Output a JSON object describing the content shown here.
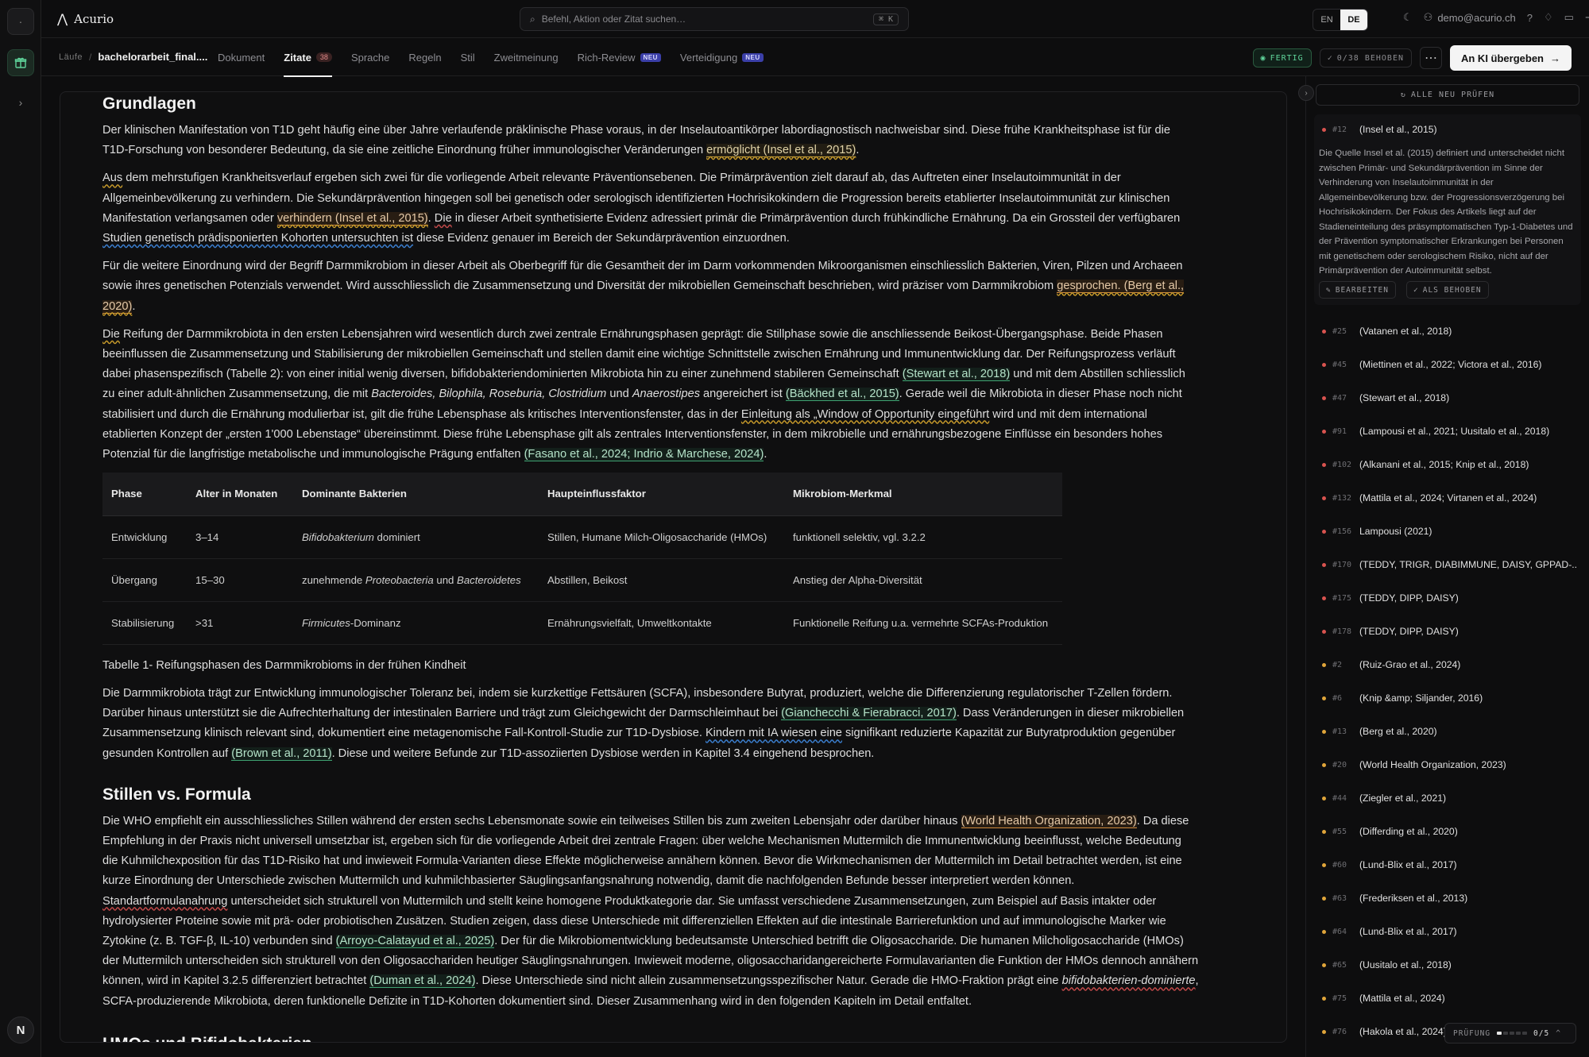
{
  "app": {
    "name": "Acurio"
  },
  "search": {
    "placeholder": "Befehl, Aktion oder Zitat suchen…",
    "shortcut": "⌘ K"
  },
  "languages": [
    {
      "code": "EN",
      "active": false
    },
    {
      "code": "DE",
      "active": true
    }
  ],
  "user": {
    "email": "demo@acurio.ch"
  },
  "breadcrumb": {
    "runs": "Läufe",
    "file": "bachelorarbeit_final...."
  },
  "tabs": [
    {
      "label": "Dokument"
    },
    {
      "label": "Zitate",
      "count": "38",
      "active": true
    },
    {
      "label": "Sprache"
    },
    {
      "label": "Regeln"
    },
    {
      "label": "Stil"
    },
    {
      "label": "Zweitmeinung"
    },
    {
      "label": "Rich-Review",
      "badge": "NEU"
    },
    {
      "label": "Verteidigung",
      "badge": "NEU"
    }
  ],
  "toolbar": {
    "status": "FERTIG",
    "fixed": "0/38 BEHOBEN",
    "handoff": "An KI übergeben"
  },
  "colors": {
    "accent_green": "#5fd39a",
    "accent_yellow": "#c79a2a",
    "accent_orange": "#d38d3e",
    "accent_red": "#c44a4a",
    "neu_badge": "#3b3fa8"
  },
  "document": {
    "h_grundlagen": "Grundlagen",
    "p1a": "Der klinischen Manifestation von T1D geht häufig eine über Jahre verlaufende präklinische Phase voraus, in der Inselautoantikörper labordiagnostisch nachweisbar sind. Diese frühe Krankheitsphase ist für die T1D-Forschung von besonderer Bedeutung, da sie eine zeitliche Einordnung früher immunologischer Veränderungen ",
    "p1b": "ermöglicht (Insel et al., 2015)",
    "p2a": "Aus",
    "p2b": " dem mehrstufigen Krankheitsverlauf ergeben sich zwei für die vorliegende Arbeit relevante Präventionsebenen. Die Primärprävention zielt darauf ab, das Auftreten einer Inselautoimmunität in der Allgemeinbevölkerung zu verhindern. Die Sekundärprävention hingegen soll bei genetisch oder serologisch identifizierten Hochrisikokindern die Progression bereits etablierter Inselautoimmunität zur klinischen Manifestation verlangsamen oder ",
    "p2c": "verhindern (Insel et al., 2015)",
    "p2d": ". ",
    "p2e": "Die",
    "p2f": " in dieser Arbeit synthetisierte Evidenz adressiert primär die Primärprävention durch frühkindliche Ernährung. Da ein Grossteil der verfügbaren ",
    "p2g": "Studien genetisch prädisponierten Kohorten untersuchten ist",
    "p2h": " diese Evidenz genauer im Bereich der Sekundärprävention einzuordnen.",
    "p3a": "Für die weitere Einordnung wird der Begriff Darmmikrobiom in dieser Arbeit als Oberbegriff für die Gesamtheit der im Darm vorkommenden Mikroorganismen einschliesslich Bakterien, Viren, Pilzen und Archaeen sowie ihres genetischen Potenzials verwendet. Wird ausschliesslich die Zusammensetzung und Diversität der mikrobiellen Gemeinschaft beschrieben, wird präziser vom Darmmikrobiom ",
    "p3b": "gesprochen. (Berg et al., 2020)",
    "p4a": "Die",
    "p4b": " Reifung der Darmmikrobiota in den ersten Lebensjahren wird wesentlich durch zwei zentrale Ernährungsphasen geprägt: die Stillphase sowie die anschliessende Beikost-Übergangsphase. Beide Phasen beeinflussen die Zusammensetzung und Stabilisierung der mikrobiellen Gemeinschaft und stellen damit eine wichtige Schnittstelle zwischen Ernährung und Immunentwicklung dar. Der Reifungsprozess verläuft dabei phasenspezifisch (Tabelle 2): von einer initial wenig diversen, bifidobakteriendominierten Mikrobiota hin zu einer zunehmend stabileren Gemeinschaft ",
    "p4c": "(Stewart et al., 2018)",
    "p4d": " und mit dem Abstillen schliesslich zu einer adult-ähnlichen Zusammensetzung, die mit ",
    "p4e": "Bacteroides, Bilophila, Roseburia, Clostridium",
    "p4f": " und ",
    "p4g": "Anaerostipes",
    "p4h": " angereichert ist ",
    "p4i": "(Bäckhed et al., 2015)",
    "p4j": ". Gerade weil die Mikrobiota in dieser Phase noch nicht stabilisiert und durch die Ernährung modulierbar ist, gilt die frühe Lebensphase als kritisches Interventionsfenster, das in der ",
    "p4k": "Einleitung als „Window of Opportunity eingeführt",
    "p4l": " wird und mit dem international etablierten Konzept der „ersten 1'000 Lebenstage“ übereinstimmt. Diese frühe Lebensphase gilt als zentrales Interventionsfenster, in dem mikrobielle und ernährungsbezogene Einflüsse ein besonders hohes Potenzial für die langfristige metabolische und immunologische Prägung entfalten ",
    "p4m": "(Fasano et al., 2024; Indrio & Marchese, 2024)",
    "table_headers": [
      "Phase",
      "Alter in Monaten",
      "Dominante Bakterien",
      "Haupteinflussfaktor",
      "Mikrobiom-Merkmal"
    ],
    "table_rows": [
      {
        "phase": "Entwicklung",
        "age": "3–14",
        "bact_it": "Bifidobakterium",
        "bact_rest": " dominiert",
        "factor": "Stillen, Humane Milch-Oligosaccharide (HMOs)",
        "feature": "funktionell selektiv, vgl. 3.2.2"
      },
      {
        "phase": "Übergang",
        "age": "15–30",
        "bact_pre": "zunehmende ",
        "bact_it1": "Proteobacteria",
        "bact_mid": " und ",
        "bact_it2": "Bacteroidetes",
        "factor": "Abstillen, Beikost",
        "feature": "Anstieg der Alpha-Diversität"
      },
      {
        "phase": "Stabilisierung",
        "age": ">31",
        "bact_it": "Firmicutes",
        "bact_rest": "-Dominanz",
        "factor": "Ernährungsvielfalt, Umweltkontakte",
        "feature": "Funktionelle Reifung u.a. vermehrte SCFAs-Produktion"
      }
    ],
    "caption": "Tabelle 1- Reifungsphasen des Darmmikrobioms in der frühen Kindheit",
    "p5a": "Die Darmmikrobiota trägt zur Entwicklung immunologischer Toleranz bei, indem sie kurzkettige Fettsäuren (SCFA), insbesondere Butyrat, produziert, welche die Differenzierung regulatorischer T-Zellen fördern. Darüber hinaus unterstützt sie die Aufrechterhaltung der intestinalen Barriere und trägt zum Gleichgewicht der Darmschleimhaut bei ",
    "p5b": "(Gianchecchi & Fierabracci, 2017)",
    "p5c": ". Dass Veränderungen in dieser mikrobiellen Zusammensetzung klinisch relevant sind, dokumentiert eine metagenomische Fall-Kontroll-Studie zur T1D-Dysbiose. ",
    "p5d": "Kindern mit IA wiesen eine",
    "p5e": " signifikant reduzierte Kapazität zur Butyratproduktion gegenüber gesunden Kontrollen auf ",
    "p5f": "(Brown et al., 2011)",
    "p5g": ". Diese und weitere Befunde zur T1D-assoziierten Dysbiose werden in Kapitel 3.4 eingehend besprochen.",
    "h_stillen": "Stillen vs. Formula",
    "p6a": "Die WHO empfiehlt ein ausschliessliches Stillen während der ersten sechs Lebensmonate sowie ein teilweises Stillen bis zum zweiten Lebensjahr oder darüber hinaus ",
    "p6b": "(World Health Organization, 2023)",
    "p6c": ". Da diese Empfehlung in der Praxis nicht universell umsetzbar ist, ergeben sich für die vorliegende Arbeit drei zentrale Fragen: über welche Mechanismen Muttermilch die Immunentwicklung beeinflusst, welche Bedeutung die Kuhmilchexposition für das T1D-Risiko hat und inwieweit Formula-Varianten diese Effekte möglicherweise annähern können. Bevor die Wirkmechanismen der Muttermilch im Detail betrachtet werden, ist eine kurze Einordnung der Unterschiede zwischen Muttermilch und kuhmilchbasierter Säuglingsanfangsnahrung notwendig, damit die nachfolgenden Befunde besser interpretiert werden können. ",
    "p6d": "Standartformulanahrung",
    "p6e": " unterscheidet sich strukturell von Muttermilch und stellt keine homogene Produktkategorie dar. Sie umfasst verschiedene Zusammensetzungen, zum Beispiel auf Basis intakter oder hydrolysierter Proteine sowie mit prä- oder probiotischen Zusätzen. Studien zeigen, dass diese Unterschiede mit differenziellen Effekten auf die intestinale Barrierefunktion und auf immunologische Marker wie Zytokine (z. B. TGF-β, IL-10) verbunden sind ",
    "p6f": "(Arroyo-Calatayud et al., 2025)",
    "p6g": ". Der für die Mikrobiomentwicklung bedeutsamste Unterschied betrifft die Oligosaccharide. Die humanen Milcholigosaccharide (HMOs) der Muttermilch unterscheiden sich strukturell von den Oligosacchariden heutiger Säuglingsnahrungen. Inwieweit moderne, oligosaccharidangereicherte Formulavarianten die Funktion der HMOs dennoch annähern können, wird in Kapitel 3.2.5 differenziert betrachtet ",
    "p6h": "(Duman et al., 2024)",
    "p6i": ". Diese Unterschiede sind nicht allein zusammensetzungsspezifischer Natur. Gerade die HMO-Fraktion prägt eine ",
    "p6j": "bifidobakterien-dominierte",
    "p6k": ", SCFA-produzierende Mikrobiota, deren funktionelle Defizite in T1D-Kohorten dokumentiert sind. Dieser Zusammenhang wird in den folgenden Kapiteln im Detail entfaltet.",
    "h_hmos": "HMOs und Bifidobakterien"
  },
  "panel": {
    "recheck": "ALLE NEU PRÜFEN",
    "expanded": {
      "num": "#12",
      "title": "(Insel et al., 2015)",
      "description": "Die Quelle Insel et al. (2015) definiert und unterscheidet nicht zwischen Primär- und Sekundärprävention im Sinne der Verhinderung von Inselautoimmunität in der Allgemeinbevölkerung bzw. der Progressionsverzögerung bei Hochrisikokindern. Der Fokus des Artikels liegt auf der Stadieneinteilung des präsymptomatischen Typ-1-Diabetes und der Prävention symptomatischer Erkrankungen bei Personen mit genetischem oder serologischem Risiko, nicht auf der Primärprävention der Autoimmunität selbst.",
      "edit": "BEARBEITEN",
      "fixed": "ALS BEHOBEN"
    },
    "issues": [
      {
        "num": "#25",
        "title": "(Vatanen et al., 2018)",
        "color": "#d9534f"
      },
      {
        "num": "#45",
        "title": "(Miettinen et al., 2022; Victora et al., 2016)",
        "color": "#d9534f"
      },
      {
        "num": "#47",
        "title": "(Stewart et al., 2018)",
        "color": "#d9534f"
      },
      {
        "num": "#91",
        "title": "(Lampousi et al., 2021; Uusitalo et al., 2018)",
        "color": "#d9534f"
      },
      {
        "num": "#102",
        "title": "(Alkanani et al., 2015; Knip et al., 2018)",
        "color": "#d9534f"
      },
      {
        "num": "#132",
        "title": "(Mattila et al., 2024; Virtanen et al., 2024)",
        "color": "#d9534f"
      },
      {
        "num": "#156",
        "title": "Lampousi (2021)",
        "color": "#d9534f"
      },
      {
        "num": "#170",
        "title": "(TEDDY, TRIGR, DIABIMMUNE, DAISY, GPPAD-...",
        "color": "#d9534f"
      },
      {
        "num": "#175",
        "title": "(TEDDY, DIPP, DAISY)",
        "color": "#d9534f"
      },
      {
        "num": "#178",
        "title": "(TEDDY, DIPP, DAISY)",
        "color": "#d9534f"
      },
      {
        "num": "#2",
        "title": "(Ruiz-Grao et al., 2024)",
        "color": "#e0a53a"
      },
      {
        "num": "#6",
        "title": "(Knip &amp; Siljander, 2016)",
        "color": "#e0a53a"
      },
      {
        "num": "#13",
        "title": "(Berg et al., 2020)",
        "color": "#e0a53a"
      },
      {
        "num": "#20",
        "title": "(World Health Organization, 2023)",
        "color": "#e0a53a"
      },
      {
        "num": "#44",
        "title": "(Ziegler et al., 2021)",
        "color": "#e0a53a"
      },
      {
        "num": "#55",
        "title": "(Differding et al., 2020)",
        "color": "#e0a53a"
      },
      {
        "num": "#60",
        "title": "(Lund-Blix et al., 2017)",
        "color": "#e0a53a"
      },
      {
        "num": "#63",
        "title": "(Frederiksen et al., 2013)",
        "color": "#e0a53a"
      },
      {
        "num": "#64",
        "title": "(Lund-Blix et al., 2017)",
        "color": "#e0a53a"
      },
      {
        "num": "#65",
        "title": "(Uusitalo et al., 2018)",
        "color": "#e0a53a"
      },
      {
        "num": "#75",
        "title": "(Mattila et al., 2024)",
        "color": "#e0a53a"
      },
      {
        "num": "#76",
        "title": "(Hakola et al., 2024)",
        "color": "#e0a53a"
      }
    ]
  },
  "pruefung": {
    "label": "PRÜFUNG",
    "progress": "0/5",
    "done_fraction": 0.2
  }
}
